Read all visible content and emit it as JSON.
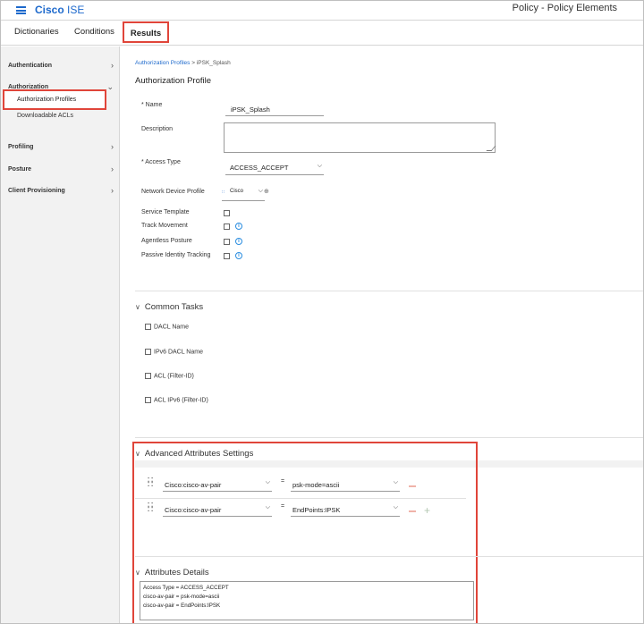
{
  "header": {
    "brand_bold": "Cisco",
    "brand_rest": "ISE",
    "page_heading": "Policy - Policy Elements"
  },
  "tabs": [
    {
      "label": "Dictionaries"
    },
    {
      "label": "Conditions"
    },
    {
      "label": "Results",
      "active": true
    }
  ],
  "sidebar": {
    "items": [
      {
        "label": "Authentication"
      },
      {
        "label": "Authorization"
      },
      {
        "label": "Profiling"
      },
      {
        "label": "Posture"
      },
      {
        "label": "Client Provisioning"
      }
    ],
    "authorization_children": [
      "Authorization Profiles",
      "Downloadable ACLs"
    ]
  },
  "breadcrumb": {
    "parent": "Authorization Profiles",
    "separator": ">",
    "current": "iPSK_Splash"
  },
  "page_title": "Authorization Profile",
  "form": {
    "name_label": "* Name",
    "name_value": "iPSK_Splash",
    "description_label": "Description",
    "access_type_label": "* Access Type",
    "access_type_value": "ACCESS_ACCEPT",
    "ndp_label": "Network Device Profile",
    "ndp_value": "Cisco",
    "service_template_label": "Service Template",
    "track_movement_label": "Track Movement",
    "agentless_posture_label": "Agentless Posture",
    "passive_identity_label": "Passive Identity Tracking"
  },
  "common_tasks": {
    "title": "Common Tasks",
    "items": [
      "DACL Name",
      "IPv6 DACL Name",
      "ACL  (Filter-ID)",
      "ACL IPv6 (Filter-ID)"
    ]
  },
  "advanced": {
    "title": "Advanced Attributes Settings",
    "rows": [
      {
        "attribute": "Cisco:cisco-av-pair",
        "operator": "=",
        "value": "psk-mode=ascii"
      },
      {
        "attribute": "Cisco:cisco-av-pair",
        "operator": "=",
        "value": "EndPoints:IPSK"
      }
    ]
  },
  "details": {
    "title": "Attributes Details",
    "lines": [
      "Access Type = ACCESS_ACCEPT",
      "cisco-av-pair = psk-mode=ascii",
      "cisco-av-pair = EndPoints:IPSK"
    ]
  },
  "colors": {
    "highlight": "#e0453a",
    "brand": "#1d69cc",
    "info": "#2a8de0"
  }
}
